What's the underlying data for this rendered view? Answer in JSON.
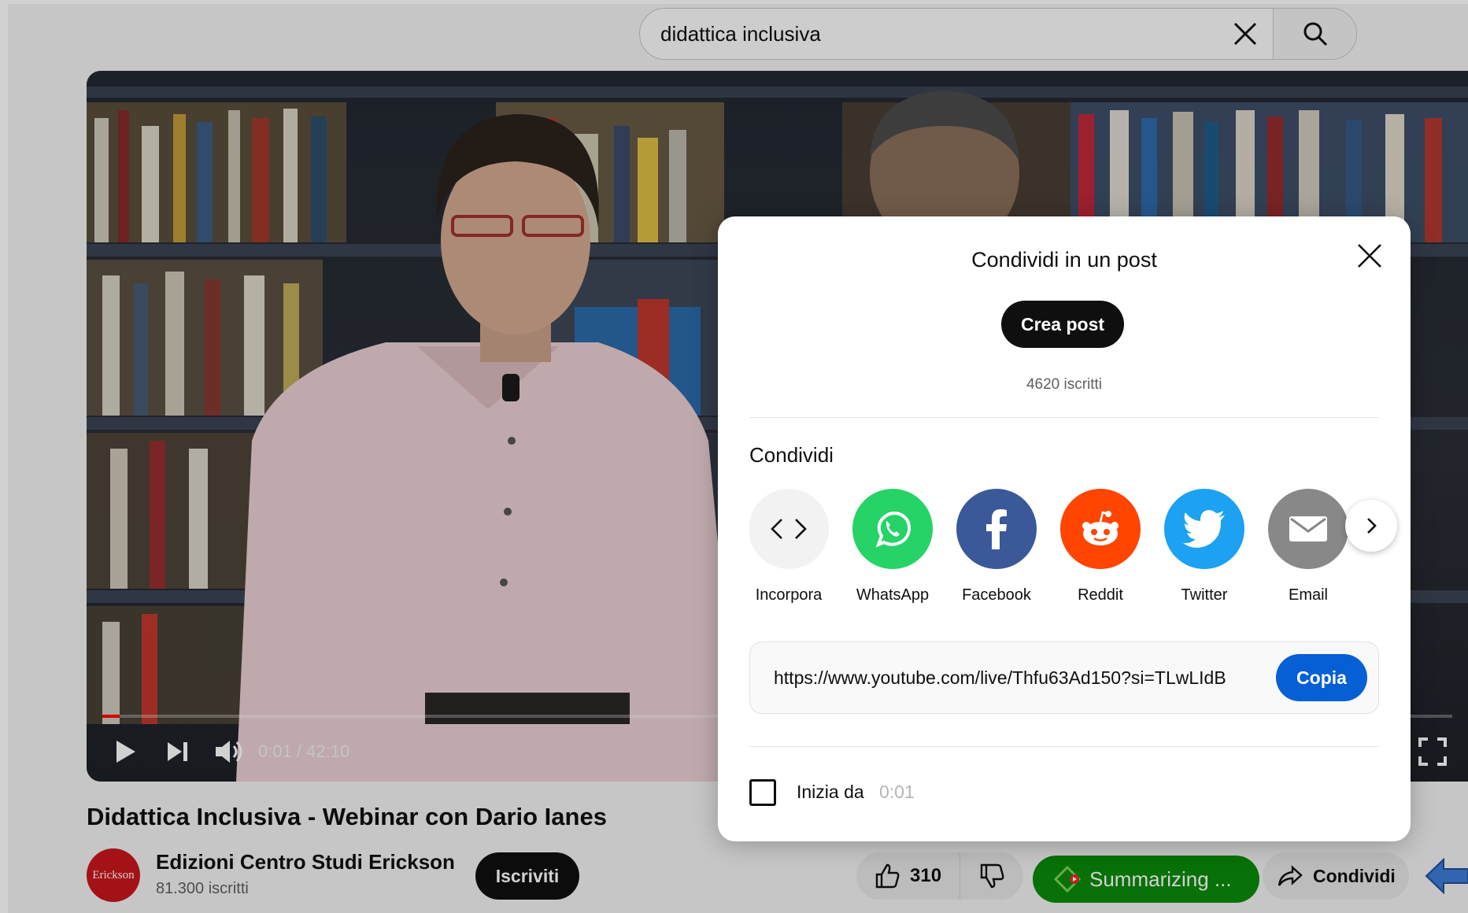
{
  "search": {
    "value": "didattica inclusiva"
  },
  "player": {
    "time": "0:01 / 42:10",
    "progress_fraction": 0.0004
  },
  "video": {
    "title": "Didattica Inclusiva - Webinar con Dario Ianes"
  },
  "channel": {
    "avatar_text": "Erickson",
    "name": "Edizioni Centro Studi Erickson",
    "subscribers": "81.300 iscritti",
    "subscribe_label": "Iscriviti"
  },
  "actions": {
    "like_count": "310",
    "summarize_label": "Summarizing ...",
    "share_label": "Condividi"
  },
  "modal": {
    "title": "Condividi in un post",
    "create_post_label": "Crea post",
    "subscribers": "4620 iscritti",
    "share_heading": "Condividi",
    "targets": [
      {
        "label": "Incorpora",
        "icon": "embed-code-icon",
        "color": "#f2f2f2"
      },
      {
        "label": "WhatsApp",
        "icon": "whatsapp-icon",
        "color": "#25d366"
      },
      {
        "label": "Facebook",
        "icon": "facebook-icon",
        "color": "#3b5998"
      },
      {
        "label": "Reddit",
        "icon": "reddit-icon",
        "color": "#ff4500"
      },
      {
        "label": "Twitter",
        "icon": "twitter-icon",
        "color": "#1da1f2"
      },
      {
        "label": "Email",
        "icon": "email-icon",
        "color": "#888888"
      }
    ],
    "url": "https://www.youtube.com/live/Thfu63Ad150?si=TLwLIdB",
    "copy_label": "Copia",
    "start_label": "Inizia da",
    "start_time": "0:01"
  },
  "colors": {
    "accent_blue": "#065fd4",
    "summarize_green": "#0a8a0a"
  }
}
